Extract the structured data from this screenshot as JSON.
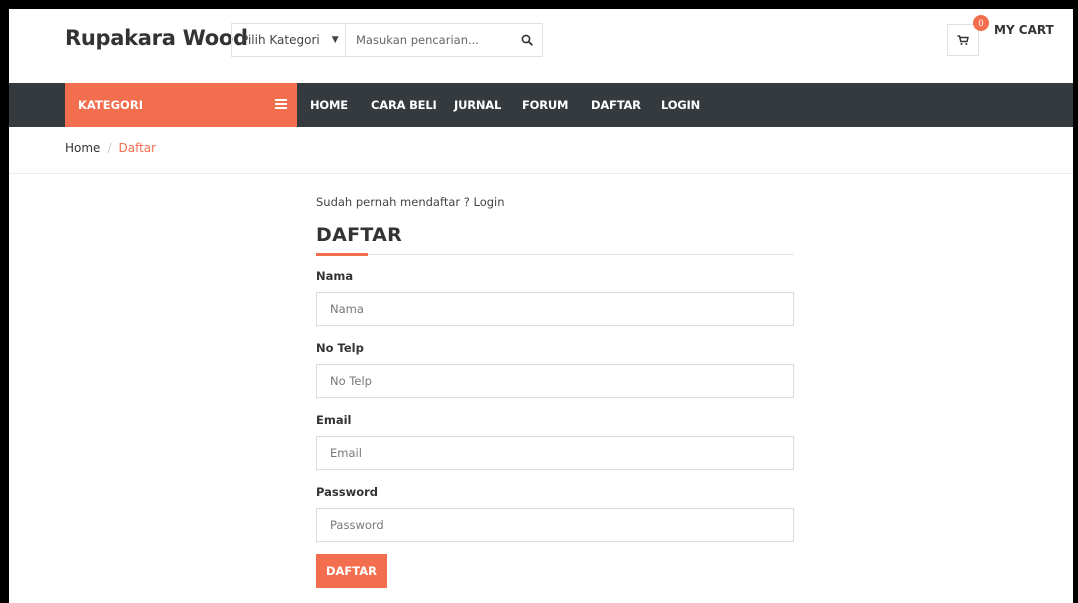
{
  "header": {
    "logo": "Rupakara Wood",
    "category_select": "Pilih Kategori",
    "search_placeholder": "Masukan pencarian...",
    "cart_count": "0",
    "cart_label": "MY CART"
  },
  "nav": {
    "kategori": "KATEGORI",
    "items": [
      "HOME",
      "CARA BELI",
      "JURNAL",
      "FORUM",
      "DAFTAR",
      "LOGIN"
    ]
  },
  "breadcrumb": {
    "home": "Home",
    "separator": "/",
    "current": "Daftar"
  },
  "form": {
    "already_registered": "Sudah pernah mendaftar ? Login",
    "title": "DAFTAR",
    "fields": [
      {
        "label": "Nama",
        "placeholder": "Nama"
      },
      {
        "label": "No Telp",
        "placeholder": "No Telp"
      },
      {
        "label": "Email",
        "placeholder": "Email"
      },
      {
        "label": "Password",
        "placeholder": "Password"
      }
    ],
    "submit": "DAFTAR"
  },
  "colors": {
    "accent": "#f26e4e",
    "navbar": "#353a3f"
  },
  "icons": {
    "search": "search-icon",
    "cart": "cart-icon",
    "menu": "menu-icon",
    "caret": "chevron-down-icon"
  }
}
